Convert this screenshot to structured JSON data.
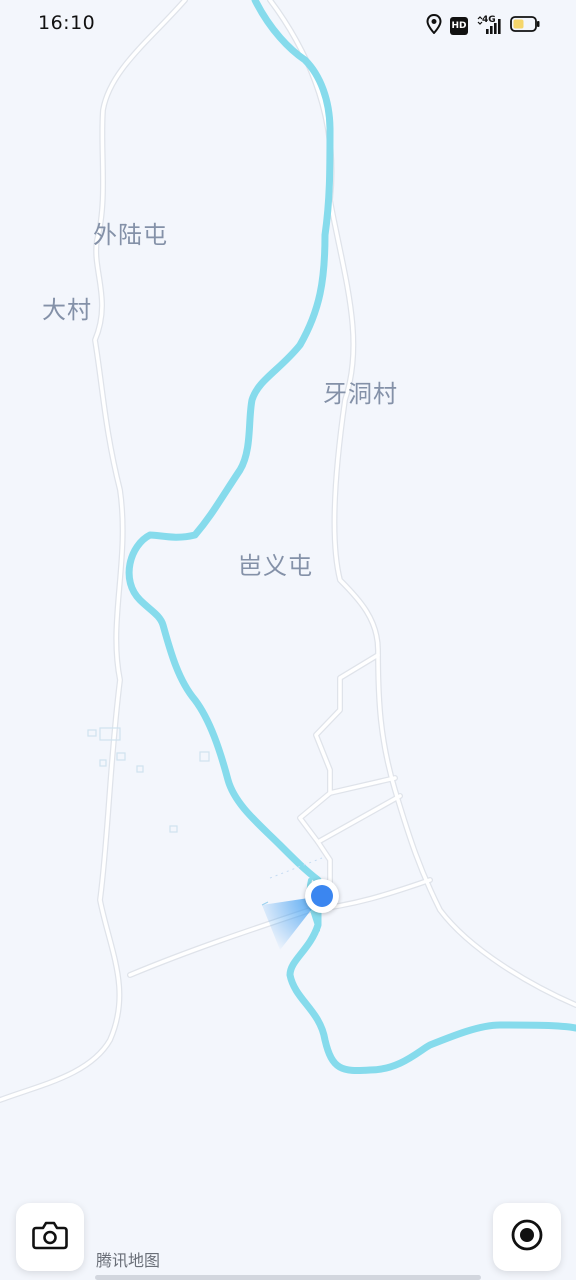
{
  "status_bar": {
    "time": "16:10",
    "hd_badge": "HD",
    "network": "4G",
    "icons": [
      "location-icon",
      "hd-icon",
      "signal-icon",
      "battery-icon"
    ],
    "battery_fill_color": "#f5d66b"
  },
  "map": {
    "background_color": "#f3f6fc",
    "road_color": "#ffffff",
    "river_color": "#86dbec",
    "places": [
      {
        "name": "外陆屯"
      },
      {
        "name": "大村"
      },
      {
        "name": "牙洞村"
      },
      {
        "name": "岜义屯"
      }
    ],
    "location_marker": {
      "color": "#3b86f0"
    }
  },
  "controls": {
    "camera_button": "camera-icon",
    "locate_button": "locate-icon"
  },
  "attribution": "腾讯地图"
}
